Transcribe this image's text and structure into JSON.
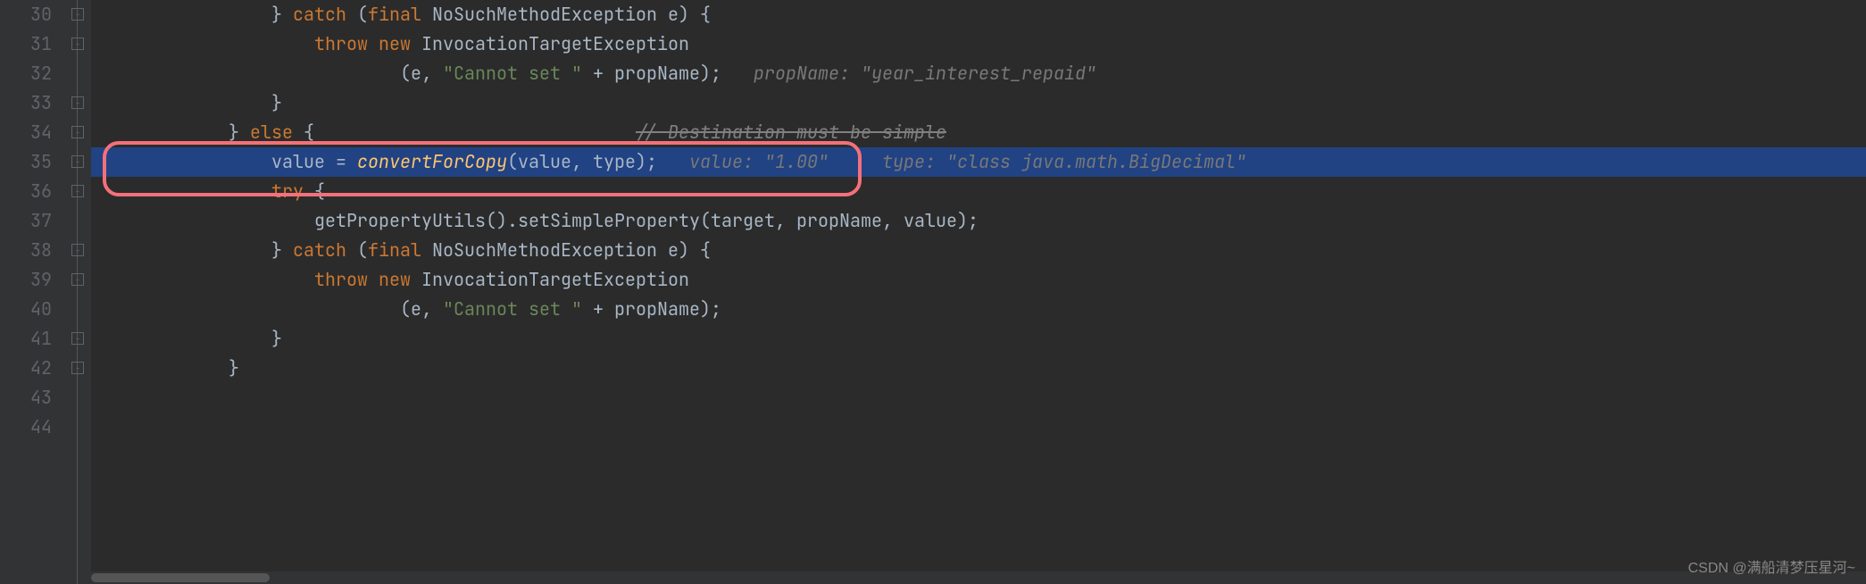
{
  "gutter": {
    "start": 30,
    "end": 44
  },
  "lines": {
    "30": {
      "indent": "                ",
      "tokens": [
        {
          "t": "} ",
          "c": "plain"
        },
        {
          "t": "catch ",
          "c": "kw"
        },
        {
          "t": "(",
          "c": "paren"
        },
        {
          "t": "final ",
          "c": "kw"
        },
        {
          "t": "NoSuchMethodException e) {",
          "c": "plain"
        }
      ]
    },
    "31": {
      "indent": "                    ",
      "tokens": [
        {
          "t": "throw new ",
          "c": "kw"
        },
        {
          "t": "InvocationTargetException",
          "c": "plain"
        }
      ]
    },
    "32": {
      "indent": "                            ",
      "tokens": [
        {
          "t": "(e, ",
          "c": "plain"
        },
        {
          "t": "\"Cannot set \"",
          "c": "str"
        },
        {
          "t": " + propName);   ",
          "c": "plain"
        },
        {
          "t": "propName: \"year_interest_repaid\"",
          "c": "param-hint"
        }
      ]
    },
    "33": {
      "indent": "                ",
      "tokens": [
        {
          "t": "}",
          "c": "plain"
        }
      ]
    },
    "34": {
      "indent": "            ",
      "tokens": [
        {
          "t": "} ",
          "c": "plain"
        },
        {
          "t": "else ",
          "c": "kw strike"
        },
        {
          "t": "{                              ",
          "c": "plain strike"
        },
        {
          "t": "// Destination must be simple",
          "c": "comment strike"
        }
      ]
    },
    "35": {
      "indent": "                ",
      "highlighted": true,
      "tokens": [
        {
          "t": "value = ",
          "c": "plain"
        },
        {
          "t": "convertForCopy",
          "c": "method"
        },
        {
          "t": "(value, type);   ",
          "c": "plain"
        },
        {
          "t": "value: \"1.00\"     type: \"class java.math.BigDecimal\"",
          "c": "param-hint"
        }
      ]
    },
    "36": {
      "indent": "                ",
      "tokens": [
        {
          "t": "try ",
          "c": "kw"
        },
        {
          "t": "{",
          "c": "plain"
        }
      ]
    },
    "37": {
      "indent": "                    ",
      "tokens": [
        {
          "t": "getPropertyUtils().setSimpleProperty(target, propName, value);",
          "c": "plain"
        }
      ]
    },
    "38": {
      "indent": "                ",
      "tokens": [
        {
          "t": "} ",
          "c": "plain"
        },
        {
          "t": "catch ",
          "c": "kw"
        },
        {
          "t": "(",
          "c": "paren"
        },
        {
          "t": "final ",
          "c": "kw"
        },
        {
          "t": "NoSuchMethodException e) {",
          "c": "plain"
        }
      ]
    },
    "39": {
      "indent": "                    ",
      "tokens": [
        {
          "t": "throw new ",
          "c": "kw"
        },
        {
          "t": "InvocationTargetException",
          "c": "plain"
        }
      ]
    },
    "40": {
      "indent": "                            ",
      "tokens": [
        {
          "t": "(e, ",
          "c": "plain"
        },
        {
          "t": "\"Cannot set \"",
          "c": "str"
        },
        {
          "t": " + propName);",
          "c": "plain"
        }
      ]
    },
    "41": {
      "indent": "                ",
      "tokens": [
        {
          "t": "}",
          "c": "plain"
        }
      ]
    },
    "42": {
      "indent": "            ",
      "tokens": [
        {
          "t": "}",
          "c": "plain"
        }
      ]
    },
    "43": {
      "indent": "",
      "tokens": []
    },
    "44": {
      "indent": "",
      "tokens": []
    }
  },
  "fold_markers": [
    30,
    31,
    33,
    34,
    35,
    36,
    38,
    39,
    41,
    42
  ],
  "watermark": "CSDN @满船清梦压星河~"
}
